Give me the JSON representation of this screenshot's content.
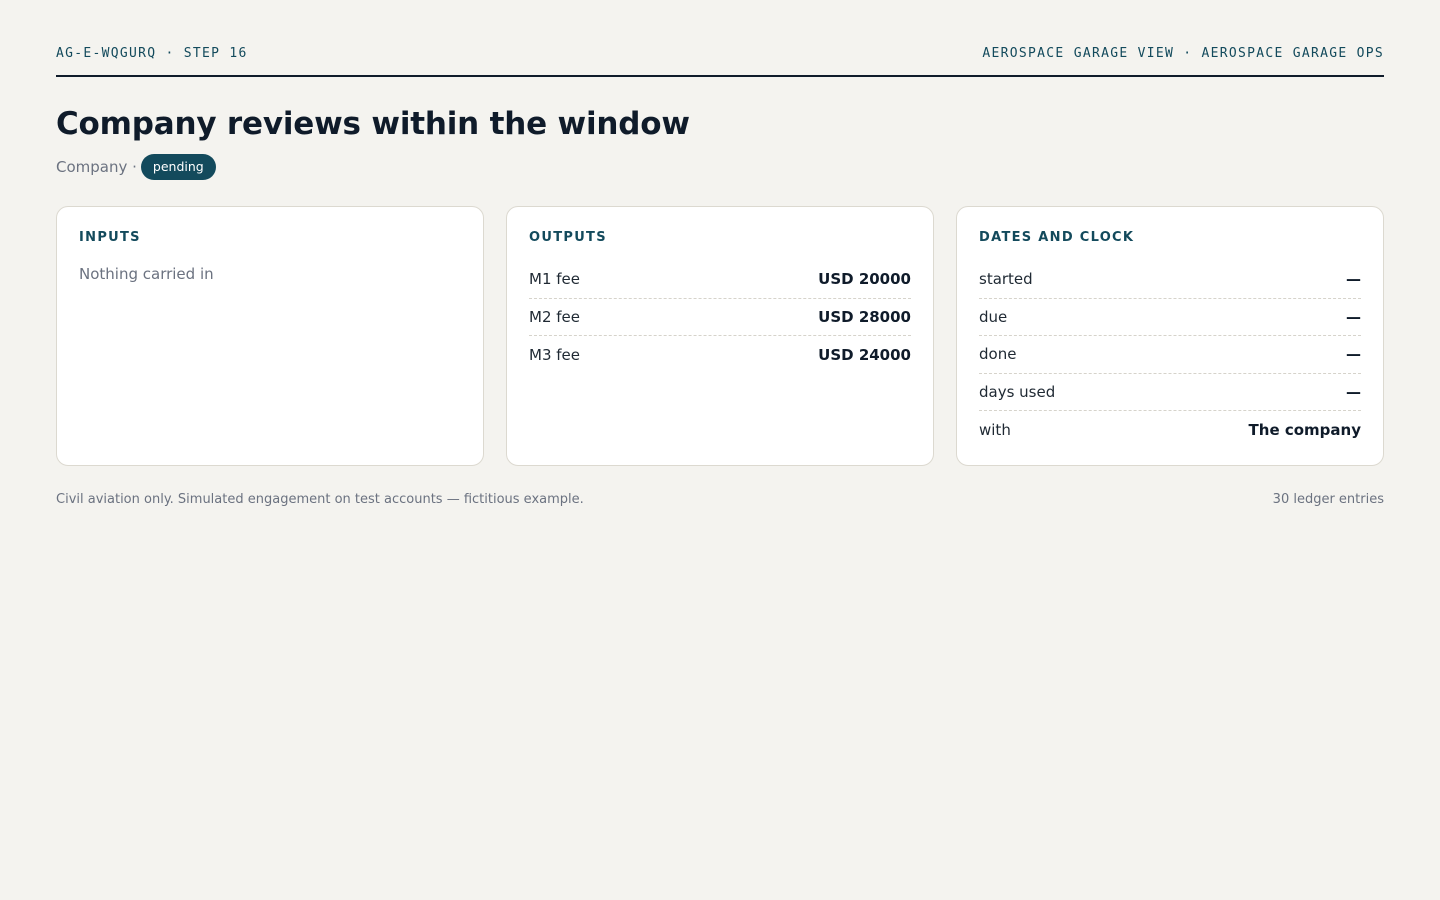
{
  "header": {
    "left": "AG-E-WQGURQ · STEP 16",
    "right": "AEROSPACE GARAGE VIEW · AEROSPACE GARAGE OPS"
  },
  "title": "Company reviews within the window",
  "subline": {
    "party": "Company ·",
    "status": "pending"
  },
  "inputs": {
    "heading": "INPUTS",
    "empty_text": "Nothing carried in"
  },
  "outputs": {
    "heading": "OUTPUTS",
    "rows": [
      {
        "label": "M1 fee",
        "value": "USD 20000"
      },
      {
        "label": "M2 fee",
        "value": "USD 28000"
      },
      {
        "label": "M3 fee",
        "value": "USD 24000"
      }
    ]
  },
  "dates": {
    "heading": "DATES AND CLOCK",
    "rows": [
      {
        "label": "started",
        "value": "—"
      },
      {
        "label": "due",
        "value": "—"
      },
      {
        "label": "done",
        "value": "—"
      },
      {
        "label": "days used",
        "value": "—"
      },
      {
        "label": "with",
        "value": "The company"
      }
    ]
  },
  "footer": {
    "note": "Civil aviation only. Simulated engagement on test accounts — fictitious example.",
    "count": "30 ledger entries"
  },
  "colors": {
    "background": "#f4f3ef",
    "accent": "#134a5c",
    "text": "#0f1b2a",
    "muted": "#6b7280"
  }
}
